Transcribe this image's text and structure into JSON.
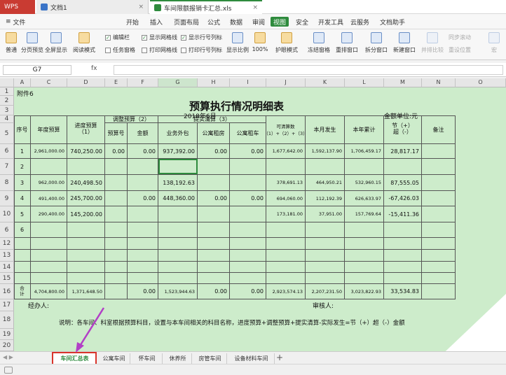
{
  "tabs": {
    "app": "WPS",
    "doc": "文档1",
    "file": "车间限额报销卡汇总.xls"
  },
  "menu": {
    "file": "文件",
    "start": "开始",
    "insert": "插入",
    "layout": "页面布局",
    "formula": "公式",
    "data": "数据",
    "review": "审阅",
    "view": "视图",
    "security": "安全",
    "dev": "开发工具",
    "cloud": "云服务",
    "assistant": "文档助手"
  },
  "ribbon": {
    "normal": "普通",
    "pagebreak": "分页预览",
    "fullscreen": "全屏显示",
    "reading": "阅读模式",
    "editbar": "编辑栏",
    "taskpane": "任务窗格",
    "showgrid": "显示网格线",
    "printgrid": "打印网格线",
    "showheaders": "显示行号列标",
    "printheaders": "打印行号列标",
    "zoom": "显示比例",
    "zoom100": "100%",
    "eyeprotect": "护眼模式",
    "freeze": "冻结窗格",
    "rearrange": "重排窗口",
    "split": "拆分窗口",
    "newwin": "新建窗口",
    "sidebyside": "并排比较",
    "sync": "同步滚动",
    "resetpos": "重设位置",
    "macro": "宏"
  },
  "formula": {
    "cellref": "G7",
    "fx": "fx"
  },
  "columns": [
    "A",
    "C",
    "D",
    "E",
    "F",
    "G",
    "H",
    "I",
    "J",
    "K",
    "L",
    "M",
    "N",
    "O"
  ],
  "rows": [
    "1",
    "2",
    "3",
    "4",
    "5",
    "6",
    "7",
    "8",
    "9",
    "10",
    "6",
    "12",
    "13",
    "14",
    "15",
    "16",
    "17",
    "18",
    "19",
    "20"
  ],
  "sheet": {
    "annex": "附件6",
    "title": "预算执行情况明细表",
    "date": "2018年6月",
    "unit": "金额单位:元",
    "h_seq": "序号",
    "h_annual": "年度预算",
    "h_progress": "进度预算\n（1）",
    "h_adjust": "调整预算（2）",
    "h_adjno": "预算号",
    "h_amount": "金额",
    "h_settle": "提实清算（3）",
    "h_outsource": "业务外包",
    "h_rent": "公寓租房",
    "h_car": "公寓租车",
    "h_avail": "可清算数（1）+（2）+（3）",
    "h_month": "本月发生",
    "h_ytd": "本年累计",
    "h_save": "节（+）\n超（-）",
    "h_remark": "备注",
    "data": [
      {
        "seq": "1",
        "annual": "2,961,000.00",
        "progress": "740,250.00",
        "adjno": "0.00",
        "amount": "0.00",
        "outsource": "937,392.00",
        "rent": "0.00",
        "car": "0.00",
        "avail": "1,677,642.00",
        "month": "1,592,137.90",
        "ytd": "1,706,459.17",
        "save": "28,817.17"
      },
      {
        "seq": "2",
        "annual": "",
        "progress": "",
        "adjno": "",
        "amount": "",
        "outsource": "",
        "rent": "",
        "car": "",
        "avail": "",
        "month": "",
        "ytd": "",
        "save": ""
      },
      {
        "seq": "3",
        "annual": "962,000.00",
        "progress": "240,498.50",
        "adjno": "",
        "amount": "",
        "outsource": "138,192.63",
        "rent": "",
        "car": "",
        "avail": "378,691.13",
        "month": "464,950.21",
        "ytd": "532,960.15",
        "save": "87,555.05"
      },
      {
        "seq": "4",
        "annual": "491,400.00",
        "progress": "245,700.00",
        "adjno": "",
        "amount": "0.00",
        "outsource": "448,360.00",
        "rent": "0.00",
        "car": "0.00",
        "avail": "694,060.00",
        "month": "112,192.39",
        "ytd": "626,633.97",
        "save": "-67,426.03"
      },
      {
        "seq": "5",
        "annual": "290,400.00",
        "progress": "145,200.00",
        "adjno": "",
        "amount": "",
        "outsource": "",
        "rent": "",
        "car": "",
        "avail": "173,181.00",
        "month": "37,951.00",
        "ytd": "157,769.64",
        "save": "-15,411.36"
      },
      {
        "seq": "6",
        "annual": "",
        "progress": "",
        "adjno": "",
        "amount": "",
        "outsource": "",
        "rent": "",
        "car": "",
        "avail": "",
        "month": "",
        "ytd": "",
        "save": ""
      }
    ],
    "total": {
      "label": "合\n计",
      "annual": "4,704,800.00",
      "progress": "1,371,648.50",
      "amount": "0.00",
      "outsource": "1,523,944.63",
      "rent": "0.00",
      "car": "0.00",
      "avail": "2,923,574.13",
      "month": "2,207,231.50",
      "ytd": "3,023,822.93",
      "save": "33,534.83"
    },
    "manager": "经办人:",
    "reviewer": "审核人:",
    "note": "说明：各车间、科室根据预算科目，设置与本车间相关的科目名称，进度预算+调整预算+提实清算-实际发生=节（+）超（-）金额"
  },
  "sheettabs": [
    "车间汇总表",
    "公寓车间",
    "怀车间",
    "休养所",
    "房管车间",
    "设备材料车间"
  ],
  "colors": {
    "accent": "#2e8b3d",
    "sheet_bg": "#cdeccb",
    "highlight": "#d9342b",
    "arrow": "#b23fc6"
  }
}
